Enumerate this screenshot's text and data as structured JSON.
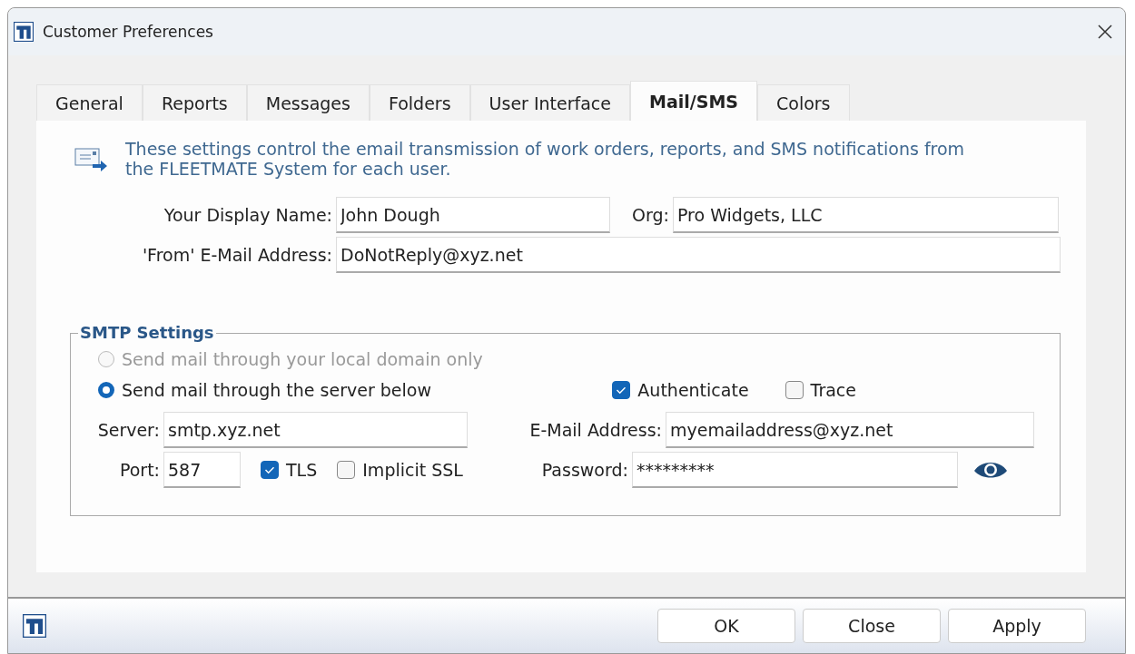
{
  "window": {
    "title": "Customer Preferences"
  },
  "tabs": [
    {
      "label": "General",
      "selected": false
    },
    {
      "label": "Reports",
      "selected": false
    },
    {
      "label": "Messages",
      "selected": false
    },
    {
      "label": "Folders",
      "selected": false
    },
    {
      "label": "User Interface",
      "selected": false
    },
    {
      "label": "Mail/SMS",
      "selected": true
    },
    {
      "label": "Colors",
      "selected": false
    }
  ],
  "intro": "These settings control the email transmission of work orders, reports, and SMS notifications from the FLEETMATE System for each user.",
  "display_name": {
    "label": "Your Display Name:",
    "value": "John Dough"
  },
  "org": {
    "label": "Org:",
    "value": "Pro Widgets, LLC"
  },
  "from_email": {
    "label": "'From' E-Mail Address:",
    "value": "DoNotReply@xyz.net"
  },
  "smtp": {
    "title": "SMTP Settings",
    "options": [
      {
        "label": "Send mail through your local domain only",
        "selected": false,
        "disabled": true
      },
      {
        "label": "Send mail through the server below",
        "selected": true,
        "disabled": false
      }
    ],
    "authenticate": {
      "label": "Authenticate",
      "checked": true
    },
    "trace": {
      "label": "Trace",
      "checked": false
    },
    "server": {
      "label": "Server:",
      "value": "smtp.xyz.net"
    },
    "email": {
      "label": "E-Mail Address:",
      "value": "myemailaddress@xyz.net"
    },
    "port": {
      "label": "Port:",
      "value": "587"
    },
    "tls": {
      "label": "TLS",
      "checked": true
    },
    "implicit_ssl": {
      "label": "Implicit SSL",
      "checked": false
    },
    "password": {
      "label": "Password:",
      "value": "*********"
    }
  },
  "buttons": [
    "OK",
    "Close",
    "Apply"
  ]
}
